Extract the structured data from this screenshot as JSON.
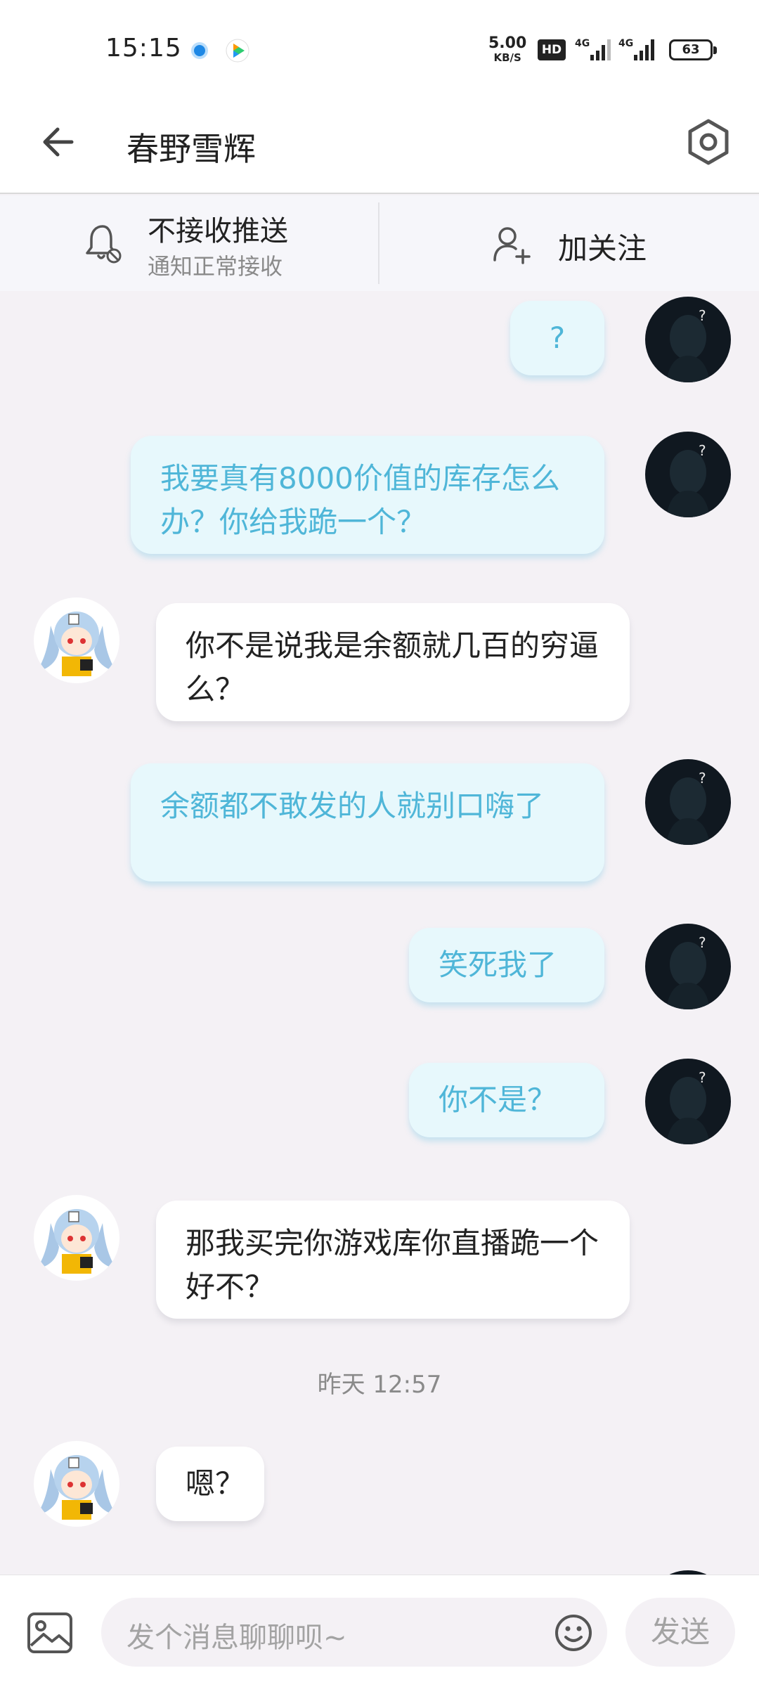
{
  "status_bar": {
    "time": "15:15",
    "net_speed": "5.00",
    "net_speed_unit": "KB/S",
    "hd_label": "HD",
    "signal_1": "4G",
    "signal_2": "4G",
    "battery": "63"
  },
  "header": {
    "title": "春野雪辉",
    "back_icon": "arrow-left-icon",
    "settings_icon": "hexagon-gear-icon"
  },
  "subscription": {
    "push_title": "不接收推送",
    "push_subtitle": "通知正常接收",
    "follow_label": "加关注"
  },
  "messages": [
    {
      "side": "out",
      "text": "?"
    },
    {
      "side": "out",
      "text": "我要真有8000价值的库存怎么办？你给我跪一个？"
    },
    {
      "side": "in",
      "text": "你不是说我是余额就几百的穷逼么？"
    },
    {
      "side": "out",
      "text": "余额都不敢发的人就别口嗨了"
    },
    {
      "side": "out",
      "text": "笑死我了"
    },
    {
      "side": "out",
      "text": "你不是？"
    },
    {
      "side": "in",
      "text": "那我买完你游戏库你直播跪一个好不？"
    },
    {
      "side": "in",
      "text": "嗯？"
    }
  ],
  "timestamp": "昨天 12:57",
  "input": {
    "placeholder": "发个消息聊聊呗~",
    "send_label": "发送"
  },
  "colors": {
    "outgoing_bubble": "#e7f8fc",
    "outgoing_text": "#4fb6d8",
    "incoming_bubble": "#ffffff",
    "background": "#f4f1f5"
  }
}
